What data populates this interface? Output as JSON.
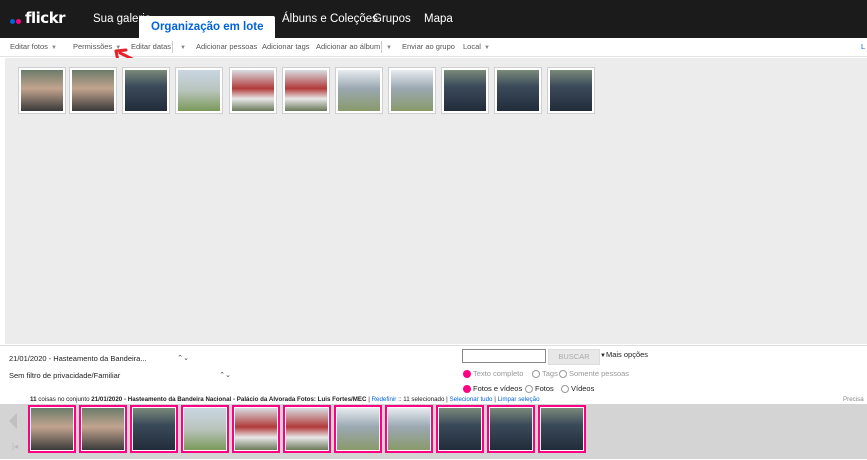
{
  "nav": {
    "logo": "flickr",
    "logo_colors": [
      "#0063dc",
      "#ff0084"
    ],
    "tabs": [
      {
        "label": "Sua galeria"
      },
      {
        "label": "Organização em lote"
      },
      {
        "label": "Álbuns e Coleções"
      },
      {
        "label": "Grupos"
      },
      {
        "label": "Mapa"
      }
    ],
    "active_tab": "Organização em lote"
  },
  "toolbar": {
    "edit_photos": "Editar fotos",
    "permissions": "Permissões",
    "edit_dates": "Editar datas",
    "add_people": "Adicionar pessoas",
    "add_tags": "Adicionar tags",
    "add_to_album": "Adicionar ao álbum",
    "send_to_group": "Enviar ao grupo",
    "location": "Local",
    "right_cut": "L"
  },
  "canvas": {
    "photo_count": 11,
    "photos": [
      {
        "icon": "photo-crowd"
      },
      {
        "icon": "photo-crowd"
      },
      {
        "icon": "photo-group"
      },
      {
        "icon": "photo-field"
      },
      {
        "icon": "photo-band"
      },
      {
        "icon": "photo-band"
      },
      {
        "icon": "photo-parade"
      },
      {
        "icon": "photo-parade"
      },
      {
        "icon": "photo-group"
      },
      {
        "icon": "photo-group"
      },
      {
        "icon": "photo-group"
      }
    ]
  },
  "annotation": {
    "color": "#e8202a"
  },
  "filters": {
    "set_select": "21/01/2020 - Hasteamento da Bandeira...",
    "privacy_select": "Sem filtro de privacidade/Familiar"
  },
  "search": {
    "value": "",
    "button": "BUSCAR",
    "more_options": "Mais opções",
    "scope_options": [
      "Texto completo",
      "Tags",
      "Somente pessoas"
    ],
    "scope_selected": "Texto completo",
    "media_options": [
      "Fotos e vídeos",
      "Fotos",
      "Vídeos"
    ],
    "media_selected": "Fotos e vídeos"
  },
  "status": {
    "count": "11",
    "text_a": "coisas no conjunto",
    "set_name": "21/01/2020 - Hasteamento da Bandeira Nacional - Palácio da Alvorada Fotos: Luis Fortes/MEC",
    "sep1": "|",
    "reset": "Redefinir",
    "sep2": "::",
    "selected": "11 selecionado",
    "sep3": "|",
    "select_all": "Selecionar tudo",
    "sep4": "|",
    "clear": "Limpar seleção",
    "right": "Precisa"
  },
  "strip": {
    "selected_color": "#ff0084"
  }
}
